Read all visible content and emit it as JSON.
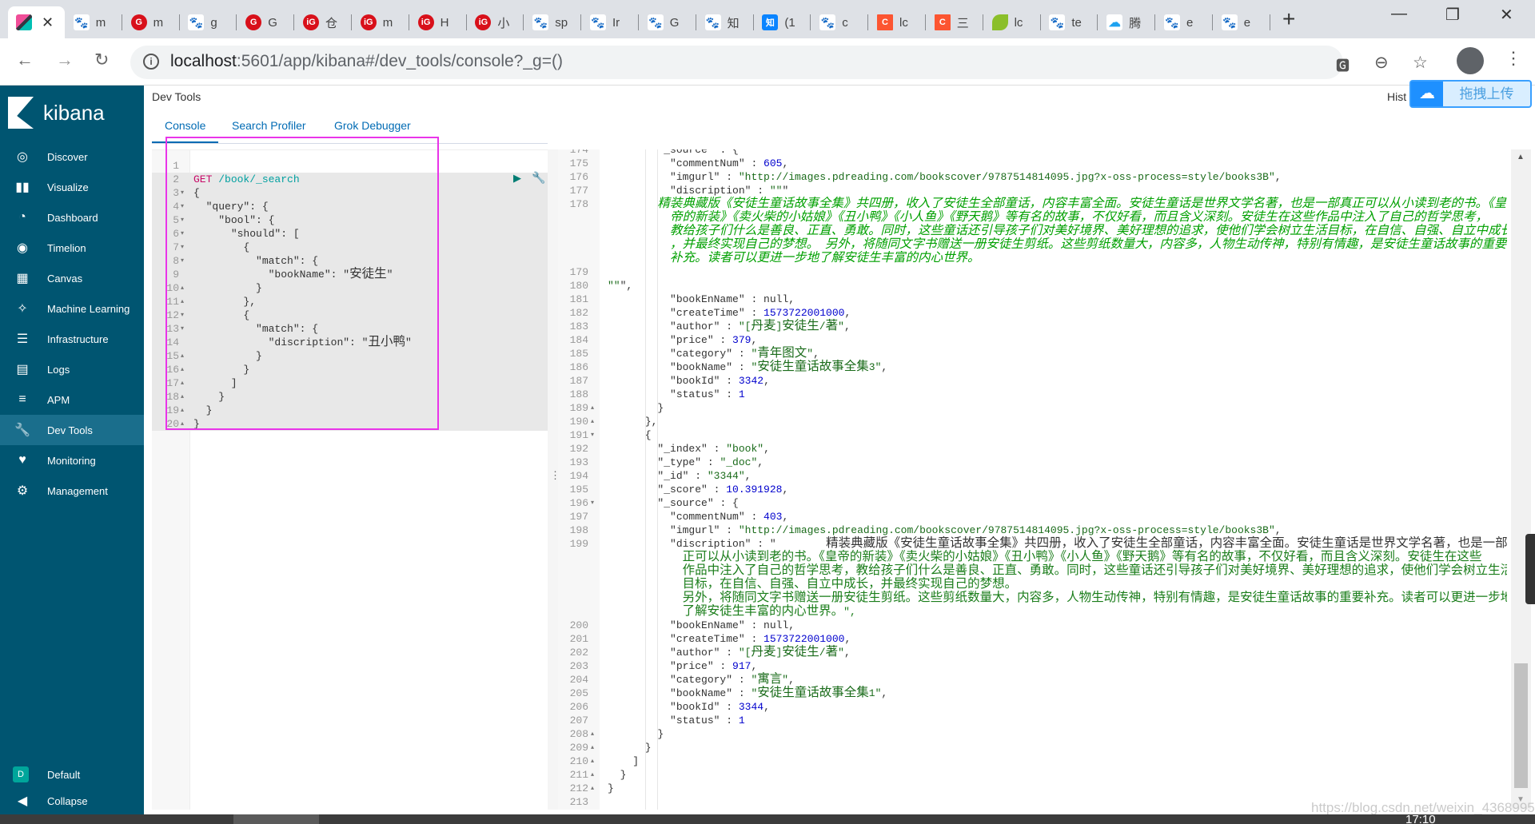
{
  "browser": {
    "tabs": [
      {
        "icon": "kibana",
        "title": "",
        "active": true
      },
      {
        "icon": "baidu",
        "title": "m"
      },
      {
        "icon": "g",
        "title": "m"
      },
      {
        "icon": "baidu",
        "title": "g"
      },
      {
        "icon": "g",
        "title": "G"
      },
      {
        "icon": "ig",
        "title": "仓"
      },
      {
        "icon": "ig",
        "title": "m"
      },
      {
        "icon": "ig",
        "title": "H"
      },
      {
        "icon": "ig",
        "title": "小"
      },
      {
        "icon": "baidu",
        "title": "sp"
      },
      {
        "icon": "baidu",
        "title": "Ir"
      },
      {
        "icon": "baidu",
        "title": "G"
      },
      {
        "icon": "baidu",
        "title": "知"
      },
      {
        "icon": "zhihu",
        "title": "(1"
      },
      {
        "icon": "baidu",
        "title": "c"
      },
      {
        "icon": "c",
        "title": "lc"
      },
      {
        "icon": "c",
        "title": "三"
      },
      {
        "icon": "leaf",
        "title": "lc"
      },
      {
        "icon": "baidu",
        "title": "te"
      },
      {
        "icon": "cloud",
        "title": "腾"
      },
      {
        "icon": "baidu",
        "title": "e"
      },
      {
        "icon": "baidu",
        "title": "e"
      }
    ],
    "url_host": "localhost",
    "url_rest": ":5601/app/kibana#/dev_tools/console?_g=()"
  },
  "sidebar": {
    "brand": "kibana",
    "items": [
      {
        "label": "Discover",
        "icon": "compass"
      },
      {
        "label": "Visualize",
        "icon": "bar-chart"
      },
      {
        "label": "Dashboard",
        "icon": "dashboard"
      },
      {
        "label": "Timelion",
        "icon": "timelion"
      },
      {
        "label": "Canvas",
        "icon": "canvas"
      },
      {
        "label": "Machine Learning",
        "icon": "ml"
      },
      {
        "label": "Infrastructure",
        "icon": "infrastructure"
      },
      {
        "label": "Logs",
        "icon": "logs"
      },
      {
        "label": "APM",
        "icon": "apm"
      },
      {
        "label": "Dev Tools",
        "icon": "wrench",
        "active": true
      },
      {
        "label": "Monitoring",
        "icon": "heartbeat"
      },
      {
        "label": "Management",
        "icon": "gear"
      }
    ],
    "space_badge": "D",
    "space_label": "Default",
    "collapse_label": "Collapse"
  },
  "header": {
    "title": "Dev Tools",
    "history": "Hist",
    "upload_widget": "拖拽上传"
  },
  "tabs": [
    "Console",
    "Search Profiler",
    "Grok Debugger"
  ],
  "active_tab": "Console",
  "editor": {
    "lines": [
      {
        "n": "1",
        "t": "",
        "f": ""
      },
      {
        "n": "2",
        "t": "GET /book/_search",
        "f": ""
      },
      {
        "n": "3",
        "t": "{",
        "f": "▾"
      },
      {
        "n": "4",
        "t": "  \"query\": {",
        "f": "▾"
      },
      {
        "n": "5",
        "t": "    \"bool\": {",
        "f": "▾"
      },
      {
        "n": "6",
        "t": "      \"should\": [",
        "f": "▾"
      },
      {
        "n": "7",
        "t": "        {",
        "f": "▾"
      },
      {
        "n": "8",
        "t": "          \"match\": {",
        "f": "▾"
      },
      {
        "n": "9",
        "t": "            \"bookName\": \"安徒生\"",
        "f": ""
      },
      {
        "n": "10",
        "t": "          }",
        "f": "▴"
      },
      {
        "n": "11",
        "t": "        },",
        "f": "▴"
      },
      {
        "n": "12",
        "t": "        {",
        "f": "▾"
      },
      {
        "n": "13",
        "t": "          \"match\": {",
        "f": "▾"
      },
      {
        "n": "14",
        "t": "            \"discription\": \"丑小鸭\"",
        "f": ""
      },
      {
        "n": "15",
        "t": "          }",
        "f": "▴"
      },
      {
        "n": "16",
        "t": "        }",
        "f": "▴"
      },
      {
        "n": "17",
        "t": "      ]",
        "f": "▴"
      },
      {
        "n": "18",
        "t": "    }",
        "f": "▴"
      },
      {
        "n": "19",
        "t": "  }",
        "f": "▴"
      },
      {
        "n": "20",
        "t": "}",
        "f": "▴"
      }
    ]
  },
  "output": {
    "lines": [
      {
        "n": "174",
        "t": "        \"_source\" : {",
        "f": ""
      },
      {
        "n": "175",
        "t": "          \"commentNum\" : 605,",
        "f": ""
      },
      {
        "n": "176",
        "t": "          \"imgurl\" : \"http://images.pdreading.com/bookscover/9787514814095.jpg?x-oss-process=style/books3B\",",
        "f": ""
      },
      {
        "n": "177",
        "t": "          \"discription\" : \"\"\"",
        "f": ""
      },
      {
        "n": "178",
        "t": "",
        "f": "",
        "wrap": "italic",
        "rows": [
          "        精装典藏版《安徒生童话故事全集》共四册，收入了安徒生全部童话，内容丰富全面。安徒生童话是世界文学名著，也是一部真正可以从小读到老的书。《皇",
          "          帝的新装》《卖火柴的小姑娘》《丑小鸭》《小人鱼》《野天鹅》等有名的故事，不仅好看，而且含义深刻。安徒生在这些作品中注入了自己的哲学思考，",
          "          教给孩子们什么是善良、正直、勇敢。同时，这些童话还引导孩子们对美好境界、美好理想的追求，使他们学会树立生活目标，在自信、自强、自立中成长",
          "          ，并最终实现自己的梦想。 另外，将随同文字书赠送一册安徒生剪纸。这些剪纸数量大，内容多，人物生动传神，特别有情趣，是安徒生童话故事的重要",
          "          补充。读者可以更进一步地了解安徒生丰富的内心世界。"
        ]
      },
      {
        "n": "179",
        "t": "",
        "f": ""
      },
      {
        "n": "180",
        "t": "\"\"\",",
        "f": ""
      },
      {
        "n": "181",
        "t": "          \"bookEnName\" : null,",
        "f": ""
      },
      {
        "n": "182",
        "t": "          \"createTime\" : 1573722001000,",
        "f": ""
      },
      {
        "n": "183",
        "t": "          \"author\" : \"[丹麦]安徒生/著\",",
        "f": ""
      },
      {
        "n": "184",
        "t": "          \"price\" : 379,",
        "f": ""
      },
      {
        "n": "185",
        "t": "          \"category\" : \"青年图文\",",
        "f": ""
      },
      {
        "n": "186",
        "t": "          \"bookName\" : \"安徒生童话故事全集3\",",
        "f": ""
      },
      {
        "n": "187",
        "t": "          \"bookId\" : 3342,",
        "f": ""
      },
      {
        "n": "188",
        "t": "          \"status\" : 1",
        "f": ""
      },
      {
        "n": "189",
        "t": "        }",
        "f": "▴"
      },
      {
        "n": "190",
        "t": "      },",
        "f": "▴"
      },
      {
        "n": "191",
        "t": "      {",
        "f": "▾"
      },
      {
        "n": "192",
        "t": "        \"_index\" : \"book\",",
        "f": ""
      },
      {
        "n": "193",
        "t": "        \"_type\" : \"_doc\",",
        "f": ""
      },
      {
        "n": "194",
        "t": "        \"_id\" : \"3344\",",
        "f": ""
      },
      {
        "n": "195",
        "t": "        \"_score\" : 10.391928,",
        "f": ""
      },
      {
        "n": "196",
        "t": "        \"_source\" : {",
        "f": "▾"
      },
      {
        "n": "197",
        "t": "          \"commentNum\" : 403,",
        "f": ""
      },
      {
        "n": "198",
        "t": "          \"imgurl\" : \"http://images.pdreading.com/bookscover/9787514814095.jpg?x-oss-process=style/books3B\",",
        "f": ""
      },
      {
        "n": "199",
        "t": "          \"discription\" : \"        精装典藏版《安徒生童话故事全集》共四册，收入了安徒生全部童话，内容丰富全面。安徒生童话是世界文学名著，也是一部真",
        "f": "",
        "wrap": "plain",
        "rows": [
          "            正可以从小读到老的书。《皇帝的新装》《卖火柴的小姑娘》《丑小鸭》《小人鱼》《野天鹅》等有名的故事，不仅好看，而且含义深刻。安徒生在这些",
          "            作品中注入了自己的哲学思考，教给孩子们什么是善良、正直、勇敢。同时，这些童话还引导孩子们对美好境界、美好理想的追求，使他们学会树立生活",
          "            目标，在自信、自强、自立中成长，并最终实现自己的梦想。",
          "            另外，将随同文字书赠送一册安徒生剪纸。这些剪纸数量大，内容多，人物生动传神，特别有情趣，是安徒生童话故事的重要补充。读者可以更进一步地",
          "            了解安徒生丰富的内心世界。\","
        ]
      },
      {
        "n": "200",
        "t": "          \"bookEnName\" : null,",
        "f": ""
      },
      {
        "n": "201",
        "t": "          \"createTime\" : 1573722001000,",
        "f": ""
      },
      {
        "n": "202",
        "t": "          \"author\" : \"[丹麦]安徒生/著\",",
        "f": ""
      },
      {
        "n": "203",
        "t": "          \"price\" : 917,",
        "f": ""
      },
      {
        "n": "204",
        "t": "          \"category\" : \"寓言\",",
        "f": ""
      },
      {
        "n": "205",
        "t": "          \"bookName\" : \"安徒生童话故事全集1\",",
        "f": ""
      },
      {
        "n": "206",
        "t": "          \"bookId\" : 3344,",
        "f": ""
      },
      {
        "n": "207",
        "t": "          \"status\" : 1",
        "f": ""
      },
      {
        "n": "208",
        "t": "        }",
        "f": "▴"
      },
      {
        "n": "209",
        "t": "      }",
        "f": "▴"
      },
      {
        "n": "210",
        "t": "    ]",
        "f": "▴"
      },
      {
        "n": "211",
        "t": "  }",
        "f": "▴"
      },
      {
        "n": "212",
        "t": "}",
        "f": "▴"
      },
      {
        "n": "213",
        "t": "",
        "f": ""
      }
    ]
  },
  "watermark": "https://blog.csdn.net/weixin_43689953",
  "clock": "17:10"
}
